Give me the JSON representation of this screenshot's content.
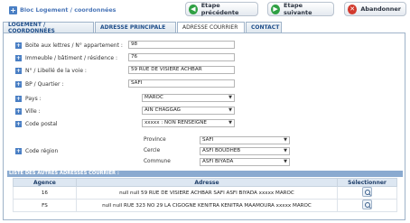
{
  "header": {
    "title": "Bloc Logement / coordonnées",
    "prev_label": "Etape précédente",
    "next_label": "Etape suivante",
    "cancel_label": "Abandonner"
  },
  "tabs": [
    {
      "label": "LOGEMENT / COORDONNÉES"
    },
    {
      "label": "ADRESSE PRINCIPALE"
    },
    {
      "label": "ADRESSE COURRIER"
    },
    {
      "label": "CONTACT"
    }
  ],
  "form": {
    "boite_label": "Boite aux lettres / N° appartement :",
    "boite_value": "98",
    "immeuble_label": "Immeuble / bâtiment / résidence :",
    "immeuble_value": "76",
    "voie_label": "N° / Libellé de la voie :",
    "voie_value": "59 RUE DE VISIERE ACHBAR",
    "bp_label": "BP / Quartier :",
    "bp_value": "SAFI",
    "pays_label": "Pays :",
    "pays_value": "MAROC",
    "ville_label": "Ville :",
    "ville_value": "AIN CHAGGAG",
    "cp_label": "Code postal",
    "cp_value": "xxxxx : NON RENSEIGNE",
    "code_region_label": "Code région",
    "province_label": "Province",
    "province_value": "SAFI",
    "cercle_label": "Cercle",
    "cercle_value": "ASFI BOUDHEB",
    "commune_label": "Commune",
    "commune_value": "ASFI BIYADA"
  },
  "list": {
    "title": "LISTE DES AUTRES ADRESSES COURRIER :",
    "columns": [
      "Agence",
      "Adresse",
      "Sélectionner"
    ],
    "rows": [
      {
        "agence": "16",
        "adresse": "null null 59 RUE DE VISIERE ACHBAR SAFI ASFI BIYADA xxxxx MAROC"
      },
      {
        "agence": "FS",
        "adresse": "null null RUE 323 NO 29 LA CIGOGNE KENITRA KENITRA MAAMOURA xxxxx MAROC"
      }
    ]
  }
}
